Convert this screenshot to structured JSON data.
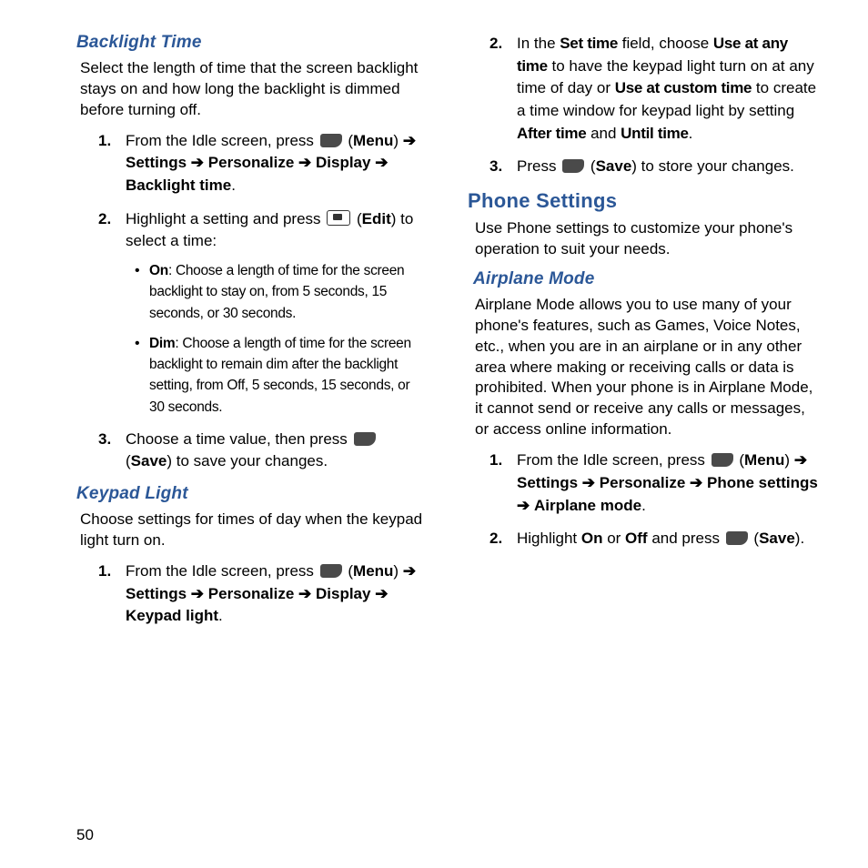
{
  "page_number": "50",
  "col1": {
    "backlight": {
      "heading": "Backlight Time",
      "intro": "Select the length of time that the screen backlight stays on and how long the backlight is dimmed before turning off.",
      "steps": {
        "s1": {
          "pre": "From the Idle screen, press ",
          "menu": "Menu",
          "settings": "Settings",
          "personalize": "Personalize",
          "display": "Display",
          "last": "Backlight time",
          "period": "."
        },
        "s2": {
          "pre": "Highlight a setting and press ",
          "edit": "Edit",
          "post": ") to select a time:"
        },
        "bullets": {
          "on_label": "On",
          "on_text": ": Choose a length of time for the screen backlight to stay on, from 5 seconds, 15 seconds, or 30 seconds.",
          "dim_label": "Dim",
          "dim_text": ": Choose a length of time for the screen backlight to remain dim after the backlight setting, from Off, 5 seconds, 15 seconds, or 30 seconds."
        },
        "s3": {
          "pre": "Choose a time value, then press ",
          "save": "Save",
          "post": ") to save your changes."
        }
      }
    },
    "keypad": {
      "heading": "Keypad Light",
      "intro": "Choose settings for times of day when the keypad light turn on.",
      "steps": {
        "s1": {
          "pre": "From the Idle screen, press ",
          "menu": "Menu",
          "settings": "Settings",
          "personalize": "Personalize",
          "display": "Display",
          "last": "Keypad light",
          "period": "."
        }
      }
    }
  },
  "col2": {
    "keypad_cont": {
      "s2": {
        "pre": "In the ",
        "set_time": "Set time",
        "mid1": " field, choose ",
        "use_any": "Use at any time",
        "mid2": " to have the keypad light turn on at any time of day or ",
        "use_custom": "Use at custom time",
        "mid3": " to create a time window for keypad light by setting ",
        "after": "After time",
        "and": " and ",
        "until": "Until time",
        "period": "."
      },
      "s3": {
        "pre": "Press ",
        "save": "Save",
        "post": ") to store your changes."
      }
    },
    "phone": {
      "section": "Phone Settings",
      "intro": "Use Phone settings to customize your phone's operation to suit your needs."
    },
    "airplane": {
      "heading": "Airplane Mode",
      "intro": "Airplane Mode allows you to use many of your phone's features, such as Games, Voice Notes, etc., when you are in an airplane or in any other area where making or receiving calls or data is prohibited. When your phone is in Airplane Mode, it cannot send or receive any calls or messages, or access online information.",
      "steps": {
        "s1": {
          "pre": "From the Idle screen, press ",
          "menu": "Menu",
          "settings": "Settings",
          "personalize": "Personalize",
          "phone_settings": "Phone settings",
          "last": "Airplane mode",
          "period": "."
        },
        "s2": {
          "pre": "Highlight ",
          "on": "On",
          "or": " or ",
          "off": "Off",
          "mid": " and press ",
          "save": "Save",
          "post": ")."
        }
      }
    }
  },
  "arrow": "➔"
}
